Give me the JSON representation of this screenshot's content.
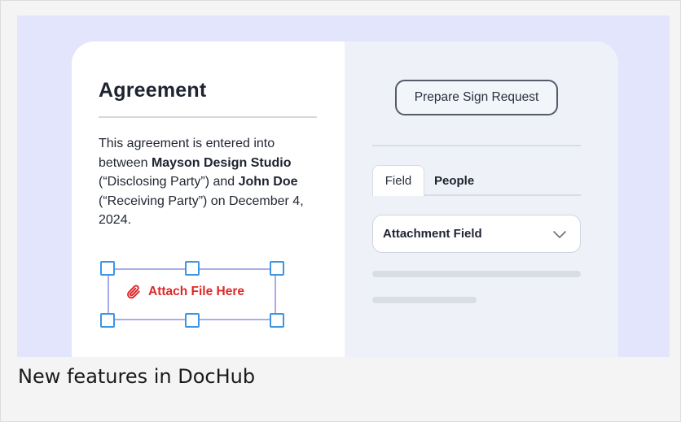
{
  "caption": "New features in DocHub",
  "document": {
    "title": "Agreement",
    "body_parts": [
      "This agreement is entered into between ",
      "Mayson Design Studio",
      " (“Disclosing Party”) and ",
      "John Doe",
      " (“Receiving Party”) on December 4, 2024."
    ],
    "attach_label": "Attach File Here",
    "attach_icon": "paperclip-icon"
  },
  "panel": {
    "prepare_button": "Prepare Sign Request",
    "tabs": [
      {
        "label": "Field",
        "selected": true
      },
      {
        "label": "People",
        "selected": false
      }
    ],
    "field_select": {
      "value": "Attachment Field",
      "icon": "chevron-down-icon"
    }
  },
  "colors": {
    "banner_bg": "#e3e5fd",
    "attach_red": "#de2828",
    "handle_blue": "#3d95e3",
    "selection_border": "#a9acec",
    "panel_bg": "#eef2f8"
  }
}
